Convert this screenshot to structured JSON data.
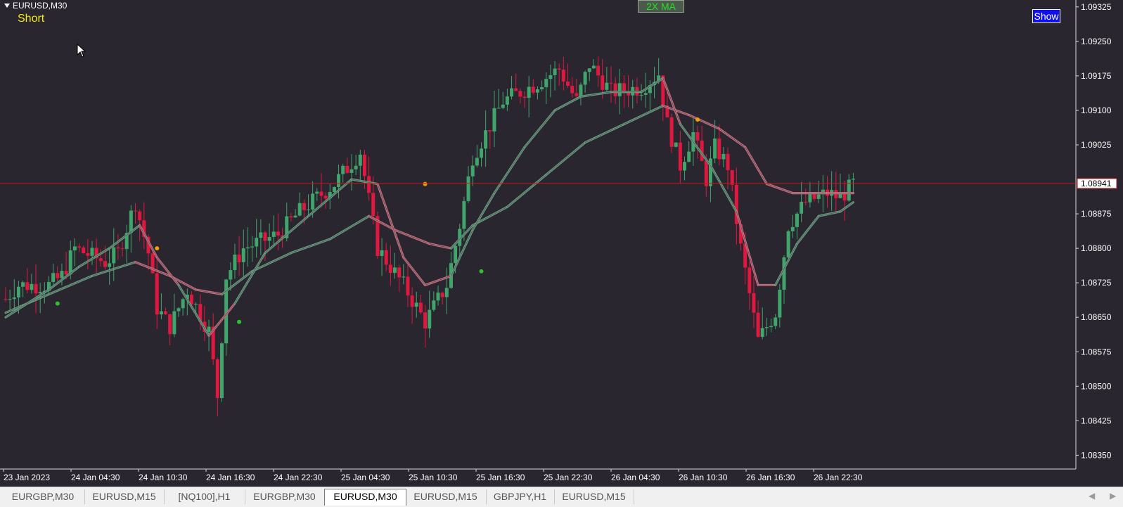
{
  "window": {
    "symbol": "EURUSD,M30",
    "signal": "Short",
    "ma_button": "2X MA",
    "show_button": "Show"
  },
  "tabs": [
    {
      "label": "EURGBP,M30",
      "active": false
    },
    {
      "label": "EURUSD,M15",
      "active": false
    },
    {
      "label": "[NQ100],H1",
      "active": false
    },
    {
      "label": "EURGBP,M30",
      "active": false
    },
    {
      "label": "EURUSD,M30",
      "active": true
    },
    {
      "label": "EURUSD,M15",
      "active": false
    },
    {
      "label": "GBPJPY,H1",
      "active": false
    },
    {
      "label": "EURUSD,M15",
      "active": false
    }
  ],
  "colors": {
    "background": "#2a2630",
    "bull": "#3fa56b",
    "bear": "#e0173f",
    "ma_bull": "#6a9a80",
    "ma_bear": "#c0707e",
    "price_line": "#c0181c",
    "axis_text": "#ffffff",
    "dot_buy": "#2ec02e",
    "dot_sell": "#f0a000"
  },
  "chart_data": {
    "type": "candlestick",
    "y_ticks": [
      "1.09325",
      "1.09250",
      "1.09175",
      "1.09100",
      "1.09025",
      "1.08875",
      "1.08800",
      "1.08725",
      "1.08650",
      "1.08575",
      "1.08500",
      "1.08425",
      "1.08350"
    ],
    "x_ticks": [
      "23 Jan 2023",
      "24 Jan 04:30",
      "24 Jan 10:30",
      "24 Jan 16:30",
      "24 Jan 22:30",
      "25 Jan 04:30",
      "25 Jan 10:30",
      "25 Jan 16:30",
      "25 Jan 22:30",
      "26 Jan 04:30",
      "26 Jan 10:30",
      "26 Jan 16:30",
      "26 Jan 22:30"
    ],
    "ylim": [
      1.0832,
      1.0934
    ],
    "current_price": 1.08941,
    "current_price_label": "1.08941",
    "close_path": [
      [
        0,
        1.0869
      ],
      [
        3,
        1.0872
      ],
      [
        10,
        1.0872
      ],
      [
        13,
        1.0874
      ],
      [
        16,
        1.088
      ],
      [
        23,
        1.0877
      ],
      [
        26,
        1.0879
      ],
      [
        30,
        1.089
      ],
      [
        33,
        1.0879
      ],
      [
        35,
        1.0867
      ],
      [
        38,
        1.0863
      ],
      [
        42,
        1.0871
      ],
      [
        47,
        1.0862
      ],
      [
        49,
        1.0848
      ],
      [
        51,
        1.0874
      ],
      [
        55,
        1.088
      ],
      [
        63,
        1.0883
      ],
      [
        68,
        1.0888
      ],
      [
        76,
        1.0894
      ],
      [
        82,
        1.0901
      ],
      [
        86,
        1.088
      ],
      [
        92,
        1.0872
      ],
      [
        97,
        1.0864
      ],
      [
        102,
        1.0872
      ],
      [
        105,
        1.0885
      ],
      [
        108,
        1.09
      ],
      [
        111,
        1.0905
      ],
      [
        115,
        1.0912
      ],
      [
        123,
        1.0916
      ],
      [
        128,
        1.0919
      ],
      [
        132,
        1.0912
      ],
      [
        135,
        1.092
      ],
      [
        140,
        1.0914
      ],
      [
        147,
        1.0915
      ],
      [
        151,
        1.0918
      ],
      [
        153,
        1.0907
      ],
      [
        156,
        1.0898
      ],
      [
        159,
        1.0905
      ],
      [
        162,
        1.0895
      ],
      [
        164,
        1.0902
      ],
      [
        167,
        1.0898
      ],
      [
        170,
        1.088
      ],
      [
        174,
        1.086
      ],
      [
        178,
        1.0866
      ],
      [
        181,
        1.0885
      ],
      [
        185,
        1.089
      ],
      [
        190,
        1.0892
      ],
      [
        193,
        1.0891
      ],
      [
        196,
        1.0894
      ]
    ],
    "ma_fast_path": [
      [
        0,
        1.0865
      ],
      [
        10,
        1.0871
      ],
      [
        17,
        1.0876
      ],
      [
        24,
        1.088
      ],
      [
        31,
        1.0885
      ],
      [
        35,
        1.0878
      ],
      [
        40,
        1.0872
      ],
      [
        47,
        1.0861
      ],
      [
        53,
        1.0868
      ],
      [
        60,
        1.0879
      ],
      [
        70,
        1.0887
      ],
      [
        80,
        1.0895
      ],
      [
        86,
        1.0894
      ],
      [
        92,
        1.0878
      ],
      [
        97,
        1.0872
      ],
      [
        103,
        1.0874
      ],
      [
        108,
        1.0884
      ],
      [
        113,
        1.0892
      ],
      [
        120,
        1.0902
      ],
      [
        127,
        1.091
      ],
      [
        133,
        1.0913
      ],
      [
        140,
        1.0914
      ],
      [
        147,
        1.0914
      ],
      [
        152,
        1.0917
      ],
      [
        156,
        1.0907
      ],
      [
        163,
        1.0898
      ],
      [
        169,
        1.0888
      ],
      [
        174,
        1.0872
      ],
      [
        178,
        1.0872
      ],
      [
        183,
        1.0881
      ],
      [
        188,
        1.0887
      ],
      [
        193,
        1.0888
      ],
      [
        196,
        1.089
      ]
    ],
    "ma_slow_path": [
      [
        0,
        1.0866
      ],
      [
        10,
        1.087
      ],
      [
        20,
        1.0874
      ],
      [
        30,
        1.0877
      ],
      [
        38,
        1.0874
      ],
      [
        44,
        1.0871
      ],
      [
        50,
        1.087
      ],
      [
        57,
        1.0875
      ],
      [
        66,
        1.0879
      ],
      [
        75,
        1.0882
      ],
      [
        84,
        1.0887
      ],
      [
        90,
        1.0884
      ],
      [
        98,
        1.0881
      ],
      [
        103,
        1.088
      ],
      [
        108,
        1.0885
      ],
      [
        116,
        1.0889
      ],
      [
        125,
        1.0896
      ],
      [
        134,
        1.0903
      ],
      [
        143,
        1.0907
      ],
      [
        152,
        1.0911
      ],
      [
        158,
        1.0909
      ],
      [
        165,
        1.0906
      ],
      [
        171,
        1.0902
      ],
      [
        176,
        1.0894
      ],
      [
        182,
        1.0892
      ],
      [
        190,
        1.0892
      ],
      [
        196,
        1.0892
      ]
    ],
    "signals": [
      {
        "type": "buy",
        "i": 12,
        "price": 1.0868
      },
      {
        "type": "sell",
        "i": 35,
        "price": 1.088
      },
      {
        "type": "buy",
        "i": 54,
        "price": 1.0864
      },
      {
        "type": "sell",
        "i": 97,
        "price": 1.0894
      },
      {
        "type": "buy",
        "i": 110,
        "price": 1.0875
      },
      {
        "type": "sell",
        "i": 160,
        "price": 1.0908
      }
    ]
  }
}
